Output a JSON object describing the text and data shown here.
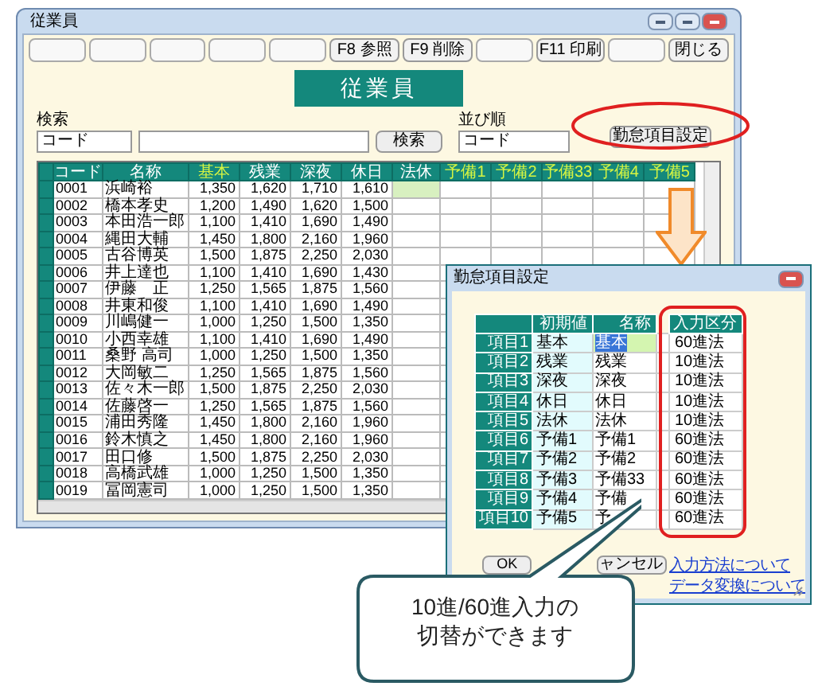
{
  "window": {
    "title": "従業員"
  },
  "toolbar": [
    {
      "kind": "blank"
    },
    {
      "kind": "blank"
    },
    {
      "kind": "blank"
    },
    {
      "kind": "blank"
    },
    {
      "kind": "blank"
    },
    {
      "kind": "key",
      "label": "F8 参照"
    },
    {
      "kind": "key",
      "label": "F9 削除"
    },
    {
      "kind": "blank"
    },
    {
      "kind": "key",
      "label": "F11 印刷"
    },
    {
      "kind": "blank"
    }
  ],
  "close_button": "閉じる",
  "banner": "従業員",
  "search": {
    "label": "検索",
    "field": "コード",
    "button": "検索"
  },
  "sort": {
    "label": "並び順",
    "field": "コード"
  },
  "settings_button": "勤怠項目設定",
  "table": {
    "columns": [
      {
        "label": "コード",
        "accent": false
      },
      {
        "label": "名称",
        "accent": false
      },
      {
        "label": "基本",
        "accent": true
      },
      {
        "label": "残業",
        "accent": false
      },
      {
        "label": "深夜",
        "accent": false
      },
      {
        "label": "休日",
        "accent": false
      },
      {
        "label": "法休",
        "accent": false
      },
      {
        "label": "予備1",
        "accent": true
      },
      {
        "label": "予備2",
        "accent": true
      },
      {
        "label": "予備33",
        "accent": true
      },
      {
        "label": "予備4",
        "accent": true
      },
      {
        "label": "予備5",
        "accent": true
      }
    ],
    "rows": [
      {
        "code": "0001",
        "name": "浜崎裕",
        "values": [
          "1,350",
          "1,620",
          "1,710",
          "1,610"
        ],
        "current": true
      },
      {
        "code": "0002",
        "name": "橋本孝史",
        "values": [
          "1,200",
          "1,490",
          "1,620",
          "1,500"
        ],
        "current": false
      },
      {
        "code": "0003",
        "name": "本田浩一郎",
        "values": [
          "1,100",
          "1,410",
          "1,690",
          "1,490"
        ],
        "current": false
      },
      {
        "code": "0004",
        "name": "縄田大輔",
        "values": [
          "1,450",
          "1,800",
          "2,160",
          "1,960"
        ],
        "current": false
      },
      {
        "code": "0005",
        "name": "古谷博英",
        "values": [
          "1,500",
          "1,875",
          "2,250",
          "2,030"
        ],
        "current": false
      },
      {
        "code": "0006",
        "name": "井上達也",
        "values": [
          "1,100",
          "1,410",
          "1,690",
          "1,430"
        ],
        "current": false
      },
      {
        "code": "0007",
        "name": "伊藤　正",
        "values": [
          "1,250",
          "1,565",
          "1,875",
          "1,560"
        ],
        "current": false
      },
      {
        "code": "0008",
        "name": "井東和俊",
        "values": [
          "1,100",
          "1,410",
          "1,690",
          "1,490"
        ],
        "current": false
      },
      {
        "code": "0009",
        "name": "川嶋健一",
        "values": [
          "1,000",
          "1,250",
          "1,500",
          "1,350"
        ],
        "current": false
      },
      {
        "code": "0010",
        "name": "小西幸雄",
        "values": [
          "1,100",
          "1,410",
          "1,690",
          "1,490"
        ],
        "current": false
      },
      {
        "code": "0011",
        "name": "桑野 高司",
        "values": [
          "1,000",
          "1,250",
          "1,500",
          "1,350"
        ],
        "current": false
      },
      {
        "code": "0012",
        "name": "大岡敏二",
        "values": [
          "1,250",
          "1,565",
          "1,875",
          "1,560"
        ],
        "current": false
      },
      {
        "code": "0013",
        "name": "佐々木一郎",
        "values": [
          "1,500",
          "1,875",
          "2,250",
          "2,030"
        ],
        "current": false
      },
      {
        "code": "0014",
        "name": "佐藤啓一",
        "values": [
          "1,250",
          "1,565",
          "1,875",
          "1,560"
        ],
        "current": false
      },
      {
        "code": "0015",
        "name": "浦田秀隆",
        "values": [
          "1,450",
          "1,800",
          "2,160",
          "1,960"
        ],
        "current": false
      },
      {
        "code": "0016",
        "name": "鈴木慎之",
        "values": [
          "1,450",
          "1,800",
          "2,160",
          "1,960"
        ],
        "current": false
      },
      {
        "code": "0017",
        "name": "田口修",
        "values": [
          "1,500",
          "1,875",
          "2,250",
          "2,030"
        ],
        "current": false
      },
      {
        "code": "0018",
        "name": "高橋武雄",
        "values": [
          "1,000",
          "1,250",
          "1,500",
          "1,350"
        ],
        "current": false
      },
      {
        "code": "0019",
        "name": "冨岡憲司",
        "values": [
          "1,000",
          "1,250",
          "1,500",
          "1,350"
        ],
        "current": false
      }
    ]
  },
  "dialog": {
    "title": "勤怠項目設定",
    "columns": [
      "初期値",
      "名称",
      "入力区分"
    ],
    "rows": [
      {
        "label": "項目1",
        "initial": "基本",
        "name": "基本",
        "mode": "60進法",
        "selected": true
      },
      {
        "label": "項目2",
        "initial": "残業",
        "name": "残業",
        "mode": "10進法",
        "selected": false
      },
      {
        "label": "項目3",
        "initial": "深夜",
        "name": "深夜",
        "mode": "10進法",
        "selected": false
      },
      {
        "label": "項目4",
        "initial": "休日",
        "name": "休日",
        "mode": "10進法",
        "selected": false
      },
      {
        "label": "項目5",
        "initial": "法休",
        "name": "法休",
        "mode": "10進法",
        "selected": false
      },
      {
        "label": "項目6",
        "initial": "予備1",
        "name": "予備1",
        "mode": "60進法",
        "selected": false
      },
      {
        "label": "項目7",
        "initial": "予備2",
        "name": "予備2",
        "mode": "60進法",
        "selected": false
      },
      {
        "label": "項目8",
        "initial": "予備3",
        "name": "予備33",
        "mode": "60進法",
        "selected": false
      },
      {
        "label": "項目9",
        "initial": "予備4",
        "name": "予備",
        "mode": "60進法",
        "selected": false
      },
      {
        "label": "項目10",
        "initial": "予備5",
        "name": "予",
        "mode": "60進法",
        "selected": false
      }
    ],
    "ok_button": "OK",
    "cancel_button": "ャンセル",
    "links": [
      "入力方法について",
      "データ変換について"
    ]
  },
  "callout": [
    "10進/60進入力の",
    "切替ができます"
  ]
}
